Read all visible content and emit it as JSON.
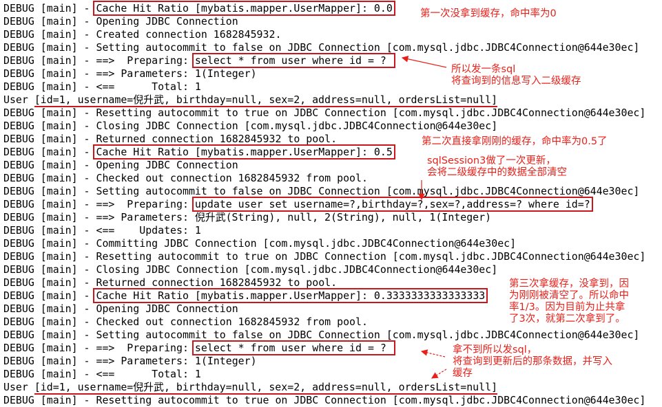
{
  "log_lines": [
    {
      "pre": "DEBUG [main] - ",
      "hl": "Cache Hit Ratio [mybatis.mapper.UserMapper]: 0.0",
      "post": "",
      "mark": "box"
    },
    {
      "pre": "DEBUG [main] - Opening JDBC Connection",
      "hl": "",
      "post": ""
    },
    {
      "pre": "DEBUG [main] - Created connection 1682845932.",
      "hl": "",
      "post": ""
    },
    {
      "pre": "DEBUG [main] - Setting autocommit to false on JDBC Connection [com.mysql.jdbc.JDBC4Connection@644e30ec]",
      "hl": "",
      "post": ""
    },
    {
      "pre": "DEBUG [main] - ==>  Preparing: ",
      "hl": "select * from user where id = ? ",
      "post": "",
      "mark": "box"
    },
    {
      "pre": "DEBUG [main] - ==> Parameters: 1(Integer)",
      "hl": "",
      "post": ""
    },
    {
      "pre": "DEBUG [main] - <==      Total: 1",
      "hl": "",
      "post": ""
    },
    {
      "pre": "User ",
      "hl": "[id=1, username=倪升武, birthday=null, sex=2, address=null, ordersList=null]",
      "post": "",
      "mark": "ul"
    },
    {
      "pre": "DEBUG [main] - Resetting autocommit to true on JDBC Connection [com.mysql.jdbc.JDBC4Connection@644e30ec]",
      "hl": "",
      "post": ""
    },
    {
      "pre": "DEBUG [main] - Closing JDBC Connection [com.mysql.jdbc.JDBC4Connection@644e30ec]",
      "hl": "",
      "post": ""
    },
    {
      "pre": "DEBUG [main] - Returned connection 1682845932 to pool.",
      "hl": "",
      "post": ""
    },
    {
      "pre": "DEBUG [main] - ",
      "hl": "Cache Hit Ratio [mybatis.mapper.UserMapper]: 0.5",
      "post": "",
      "mark": "box"
    },
    {
      "pre": "DEBUG [main] - Opening JDBC Connection",
      "hl": "",
      "post": ""
    },
    {
      "pre": "DEBUG [main] - Checked out connection 1682845932 from pool.",
      "hl": "",
      "post": ""
    },
    {
      "pre": "DEBUG [main] - Setting autocommit to false on JDBC Connection [com.mysql.jdbc.JDBC4Connection@644e30ec]",
      "hl": "",
      "post": ""
    },
    {
      "pre": "DEBUG [main] - ==>  Preparing: ",
      "hl": "update user set username=?,birthday=?,sex=?,address=? where id=?",
      "post": "",
      "mark": "box"
    },
    {
      "pre": "DEBUG [main] - ==> Parameters: 倪升武(String), null, 2(String), null, 1(Integer)",
      "hl": "",
      "post": ""
    },
    {
      "pre": "DEBUG [main] - <==    Updates: 1",
      "hl": "",
      "post": ""
    },
    {
      "pre": "DEBUG [main] - Committing JDBC Connection [com.mysql.jdbc.JDBC4Connection@644e30ec]",
      "hl": "",
      "post": ""
    },
    {
      "pre": "DEBUG [main] - Resetting autocommit to true on JDBC Connection [com.mysql.jdbc.JDBC4Connection@644e30ec]",
      "hl": "",
      "post": ""
    },
    {
      "pre": "DEBUG [main] - Closing JDBC Connection [com.mysql.jdbc.JDBC4Connection@644e30ec]",
      "hl": "",
      "post": ""
    },
    {
      "pre": "DEBUG [main] - Returned connection 1682845932 to pool.",
      "hl": "",
      "post": ""
    },
    {
      "pre": "DEBUG [main] - ",
      "hl": "Cache Hit Ratio [mybatis.mapper.UserMapper]: 0.3333333333333333",
      "post": "",
      "mark": "box"
    },
    {
      "pre": "DEBUG [main] - Opening JDBC Connection",
      "hl": "",
      "post": ""
    },
    {
      "pre": "DEBUG [main] - Checked out connection 1682845932 from pool.",
      "hl": "",
      "post": ""
    },
    {
      "pre": "DEBUG [main] - Setting autocommit to false on JDBC Connection [com.mysql.jdbc.JDBC4Connection@644e30ec]",
      "hl": "",
      "post": ""
    },
    {
      "pre": "DEBUG [main] - ==>  Preparing: ",
      "hl": "select * from user where id = ? ",
      "post": "",
      "mark": "box"
    },
    {
      "pre": "DEBUG [main] - ==> Parameters: 1(Integer)",
      "hl": "",
      "post": ""
    },
    {
      "pre": "DEBUG [main] - <==      Total: 1",
      "hl": "",
      "post": ""
    },
    {
      "pre": "User ",
      "hl": "[id=1, username=倪升武, birthday=null, sex=2, address=null, ordersList=null]",
      "post": "",
      "mark": "ul"
    },
    {
      "pre": "DEBUG [main] - Resetting autocommit to true on JDBC Connection [com.mysql.jdbc.JDBC4Connection@644e30ec]",
      "hl": "",
      "post": ""
    }
  ],
  "annotations": {
    "first_miss": "第一次没拿到缓存，命中率为0",
    "send_sql": "所以发一条sql\n将查询到的信息写入二级缓存",
    "second_hit": "第二次直接拿刚刚的缓存，命中率为0.5了",
    "session3_update": "sqlSession3做了一次更新，\n会将二级缓存中的数据全部清空",
    "third_miss": "第三次拿缓存，没拿到，因\n为刚刚被清空了。所以命中\n率1/3。因为目前为止共拿\n了3次，就第二次拿到了。",
    "send_sql_again": "拿不到所以发sql，\n将查询到更新后的那条数据，并写入\n缓存"
  },
  "colors": {
    "annotation": "#e8201a",
    "box": "#c8161d",
    "text": "#000000"
  }
}
